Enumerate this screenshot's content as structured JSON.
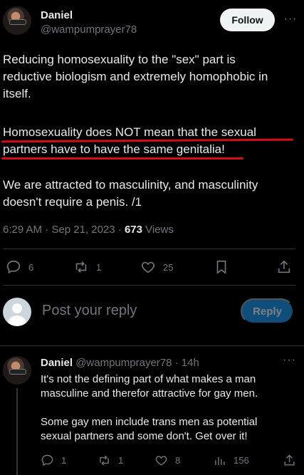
{
  "tweet": {
    "author_name": "Daniel",
    "author_handle": "@wampumprayer78",
    "follow_label": "Follow",
    "more_label": "···",
    "text_line1": "Reducing homosexuality to the \"sex\" part is",
    "text_line2": "reductive biologism and extremely homophobic in",
    "text_line3": "itself.",
    "para2_line1": "Homosexuality does NOT mean that the sexual",
    "para2_line2": "partners have to have the same genitalia!",
    "para3_line1": "We are attracted to masculinity, and masculinity",
    "para3_line2": "doesn't require a penis. /1",
    "timestamp": "6:29 AM · Sep 21, 2023 · ",
    "views_count": "673",
    "views_label": " Views",
    "reply_count": "6",
    "retweet_count": "1",
    "like_count": "25",
    "annotation_color": "#d10e16"
  },
  "composer": {
    "placeholder": "Post your reply",
    "reply_button": "Reply"
  },
  "reply": {
    "author_name": "Daniel",
    "author_handle": "@wampumprayer78",
    "time": " · 14h",
    "more_label": "···",
    "line1": "It's not the defining part of what makes a man",
    "line2": "masculine and therefor attractive for gay men.",
    "line3": "Some gay men include trans men as potential",
    "line4": "sexual partners and some don't. Get over it!",
    "reply_count": "1",
    "retweet_count": "1",
    "like_count": "8",
    "views_count": "156"
  },
  "icons": [
    "reply-icon",
    "retweet-icon",
    "like-icon",
    "bookmark-icon",
    "share-icon",
    "views-icon"
  ]
}
